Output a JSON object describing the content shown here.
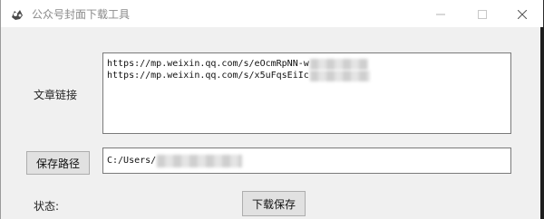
{
  "window": {
    "title": "公众号封面下载工具",
    "icon": "gear-app-icon"
  },
  "controls": {
    "minimize": "minimize-icon",
    "maximize": "maximize-icon",
    "close": "close-icon"
  },
  "form": {
    "links_label": "文章链接",
    "links": [
      "https://mp.weixin.qq.com/s/eOcmRpNN-w",
      "https://mp.weixin.qq.com/s/x5uFqsEiIc"
    ],
    "save_path_button": "保存路径",
    "save_path_value": "C:/Users/",
    "status_label": "状态:",
    "download_button": "下载保存"
  }
}
